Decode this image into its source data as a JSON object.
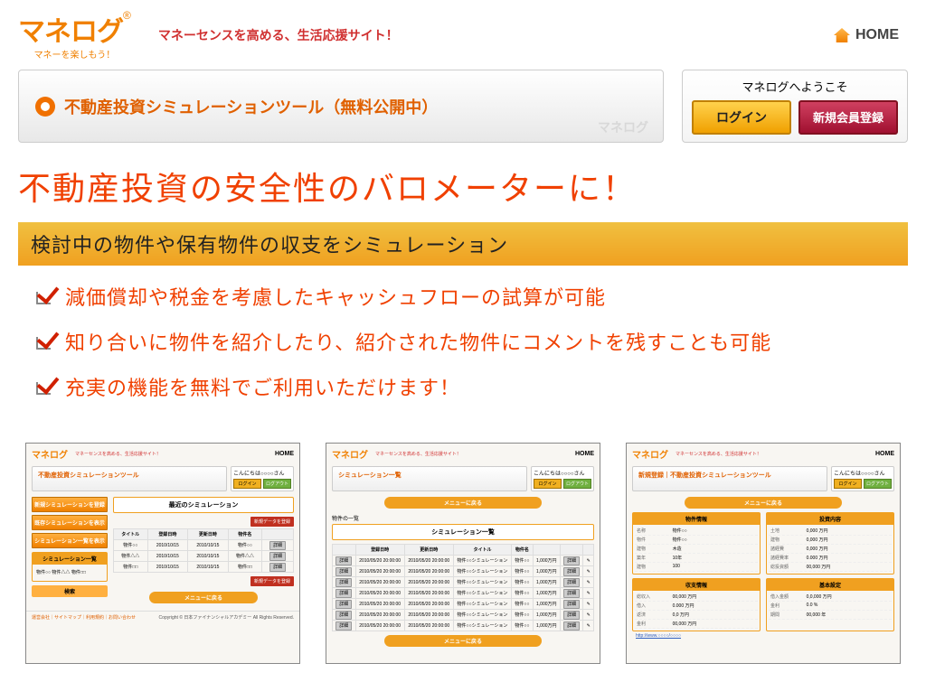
{
  "logo": {
    "text": "マネログ",
    "subtitle": "マネーを楽しもう！",
    "registered": "®"
  },
  "tagline": "マネーセンスを高める、生活応援サイト！",
  "home_label": "HOME",
  "tool_banner": {
    "text": "不動産投資シミュレーションツール（無料公開中）",
    "brand": "マネログ"
  },
  "login_box": {
    "welcome": "マネログへようこそ",
    "login_label": "ログイン",
    "register_label": "新規会員登録"
  },
  "headline": "不動産投資の安全性のバロメーターに！",
  "sub_banner": "検討中の物件や保有物件の収支をシミュレーション",
  "features": [
    "減価償却や税金を考慮したキャッシュフローの試算が可能",
    "知り合いに物件を紹介したり、紹介された物件にコメントを残すことも可能",
    "充実の機能を無料でご利用いただけます！"
  ],
  "thumbs": {
    "common": {
      "logo": "マネログ",
      "tag": "マネーセンスを高める、生活応援サイト！",
      "home": "HOME",
      "login_hello": "こんにちは○○○○さん",
      "login_y": "ログイン",
      "login_g": "ログアウト",
      "pill": "メニューに戻る"
    },
    "t1": {
      "bar": "不動産投資シミュレーションツール",
      "side_btns": [
        "新規シミュレーションを登録",
        "既存シミュレーションを表示",
        "シミュレーション一覧を表示"
      ],
      "side_box_h": "シミュレーション一覧",
      "side_box_b": "物件○○ 物件△△ 物件□□",
      "search": "検索",
      "main_h": "最近のシミュレーション",
      "action": "新規データを登録",
      "cols": [
        "タイトル",
        "登録日時",
        "更新日時",
        "物件名",
        ""
      ],
      "rows": [
        [
          "物件○○",
          "2010/10/15",
          "2010/10/15",
          "物件○○",
          "詳細"
        ],
        [
          "物件△△",
          "2010/10/15",
          "2010/10/15",
          "物件△△",
          "詳細"
        ],
        [
          "物件□□",
          "2010/10/15",
          "2010/10/15",
          "物件□□",
          "詳細"
        ]
      ]
    },
    "t2": {
      "bar": "シミュレーション一覧",
      "search_label": "物件の一覧",
      "cols": [
        "",
        "登録日時",
        "更新日時",
        "タイトル",
        "物件名",
        "",
        "",
        ""
      ],
      "rowcell": [
        "詳細",
        "2010/05/20 20:00:00",
        "2010/05/20 20:00:00",
        "物件○○シミュレーション",
        "物件○○",
        "1,000万円",
        "詳細",
        ""
      ]
    },
    "t3": {
      "bar": "新規登録｜不動産投資シミュレーションツール",
      "boxes": {
        "a": {
          "h": "物件情報",
          "rows": [
            [
              "名称",
              "物件○○"
            ],
            [
              "物件",
              "物件○○"
            ],
            [
              "建物",
              "木造"
            ],
            [
              "築年",
              "10年"
            ],
            [
              "建物",
              "100"
            ]
          ]
        },
        "b": {
          "h": "投資内容",
          "rows": [
            [
              "土地",
              "0,000 万円"
            ],
            [
              "建物",
              "0,000 万円"
            ],
            [
              "諸経費",
              "0,000 万円"
            ],
            [
              "諸経費率",
              "0.000 万円"
            ],
            [
              "総投資額",
              "00,000 万円"
            ]
          ]
        },
        "c": {
          "h": "収支情報",
          "rows": [
            [
              "総収入",
              "00,000 万円"
            ],
            [
              "借入",
              "0.000 万円"
            ],
            [
              "返済",
              "0,0 万円"
            ],
            [
              "金利",
              "00,000 万円"
            ]
          ]
        },
        "d": {
          "h": "基本設定",
          "rows": [
            [
              "借入金額",
              "0,0,000 万円"
            ],
            [
              "金利",
              "0.0 %"
            ],
            [
              "期間",
              "00,000 年"
            ]
          ]
        }
      },
      "link": "http://www.○○○○/○○○○"
    },
    "footer": {
      "links": "運営会社｜サイトマップ｜利用規約｜お問い合わせ",
      "copy": "Copyright © 日本ファイナンシャルアカデミー All Rights Reserved."
    }
  }
}
